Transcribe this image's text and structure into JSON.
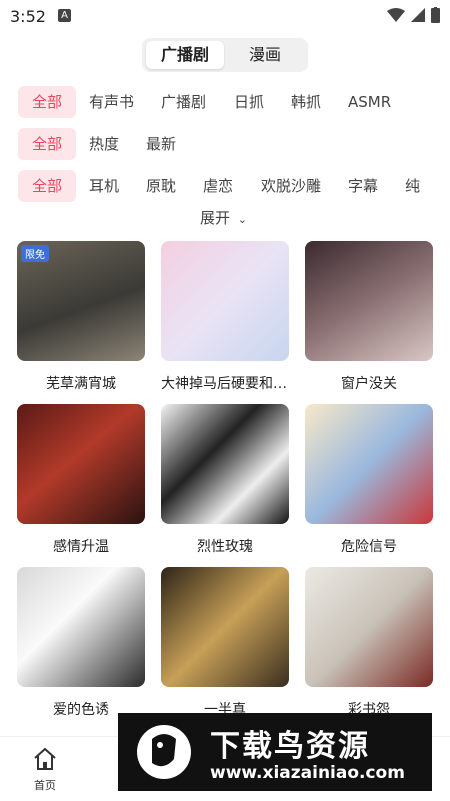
{
  "status": {
    "time": "3:52"
  },
  "tabs": [
    {
      "label": "广播剧"
    },
    {
      "label": "漫画"
    }
  ],
  "filters": {
    "row1": [
      "全部",
      "有声书",
      "广播剧",
      "日抓",
      "韩抓",
      "ASMR"
    ],
    "row2": [
      "全部",
      "热度",
      "最新"
    ],
    "row3": [
      "全部",
      "耳机",
      "原耽",
      "虐恋",
      "欢脱沙雕",
      "字幕",
      "纯"
    ],
    "expand": "展开"
  },
  "badge": "限免",
  "items": [
    {
      "title": "芜草满宵城"
    },
    {
      "title": "大神掉马后硬要和我..."
    },
    {
      "title": "窗户没关"
    },
    {
      "title": "感情升温"
    },
    {
      "title": "烈性玫瑰"
    },
    {
      "title": "危险信号"
    },
    {
      "title": "爱的色诱"
    },
    {
      "title": "一半真"
    },
    {
      "title": "彩书怨"
    }
  ],
  "nav": {
    "home": "首页"
  },
  "watermark": {
    "main": "下载鸟资源",
    "url": "www.xiazainiao.com"
  }
}
